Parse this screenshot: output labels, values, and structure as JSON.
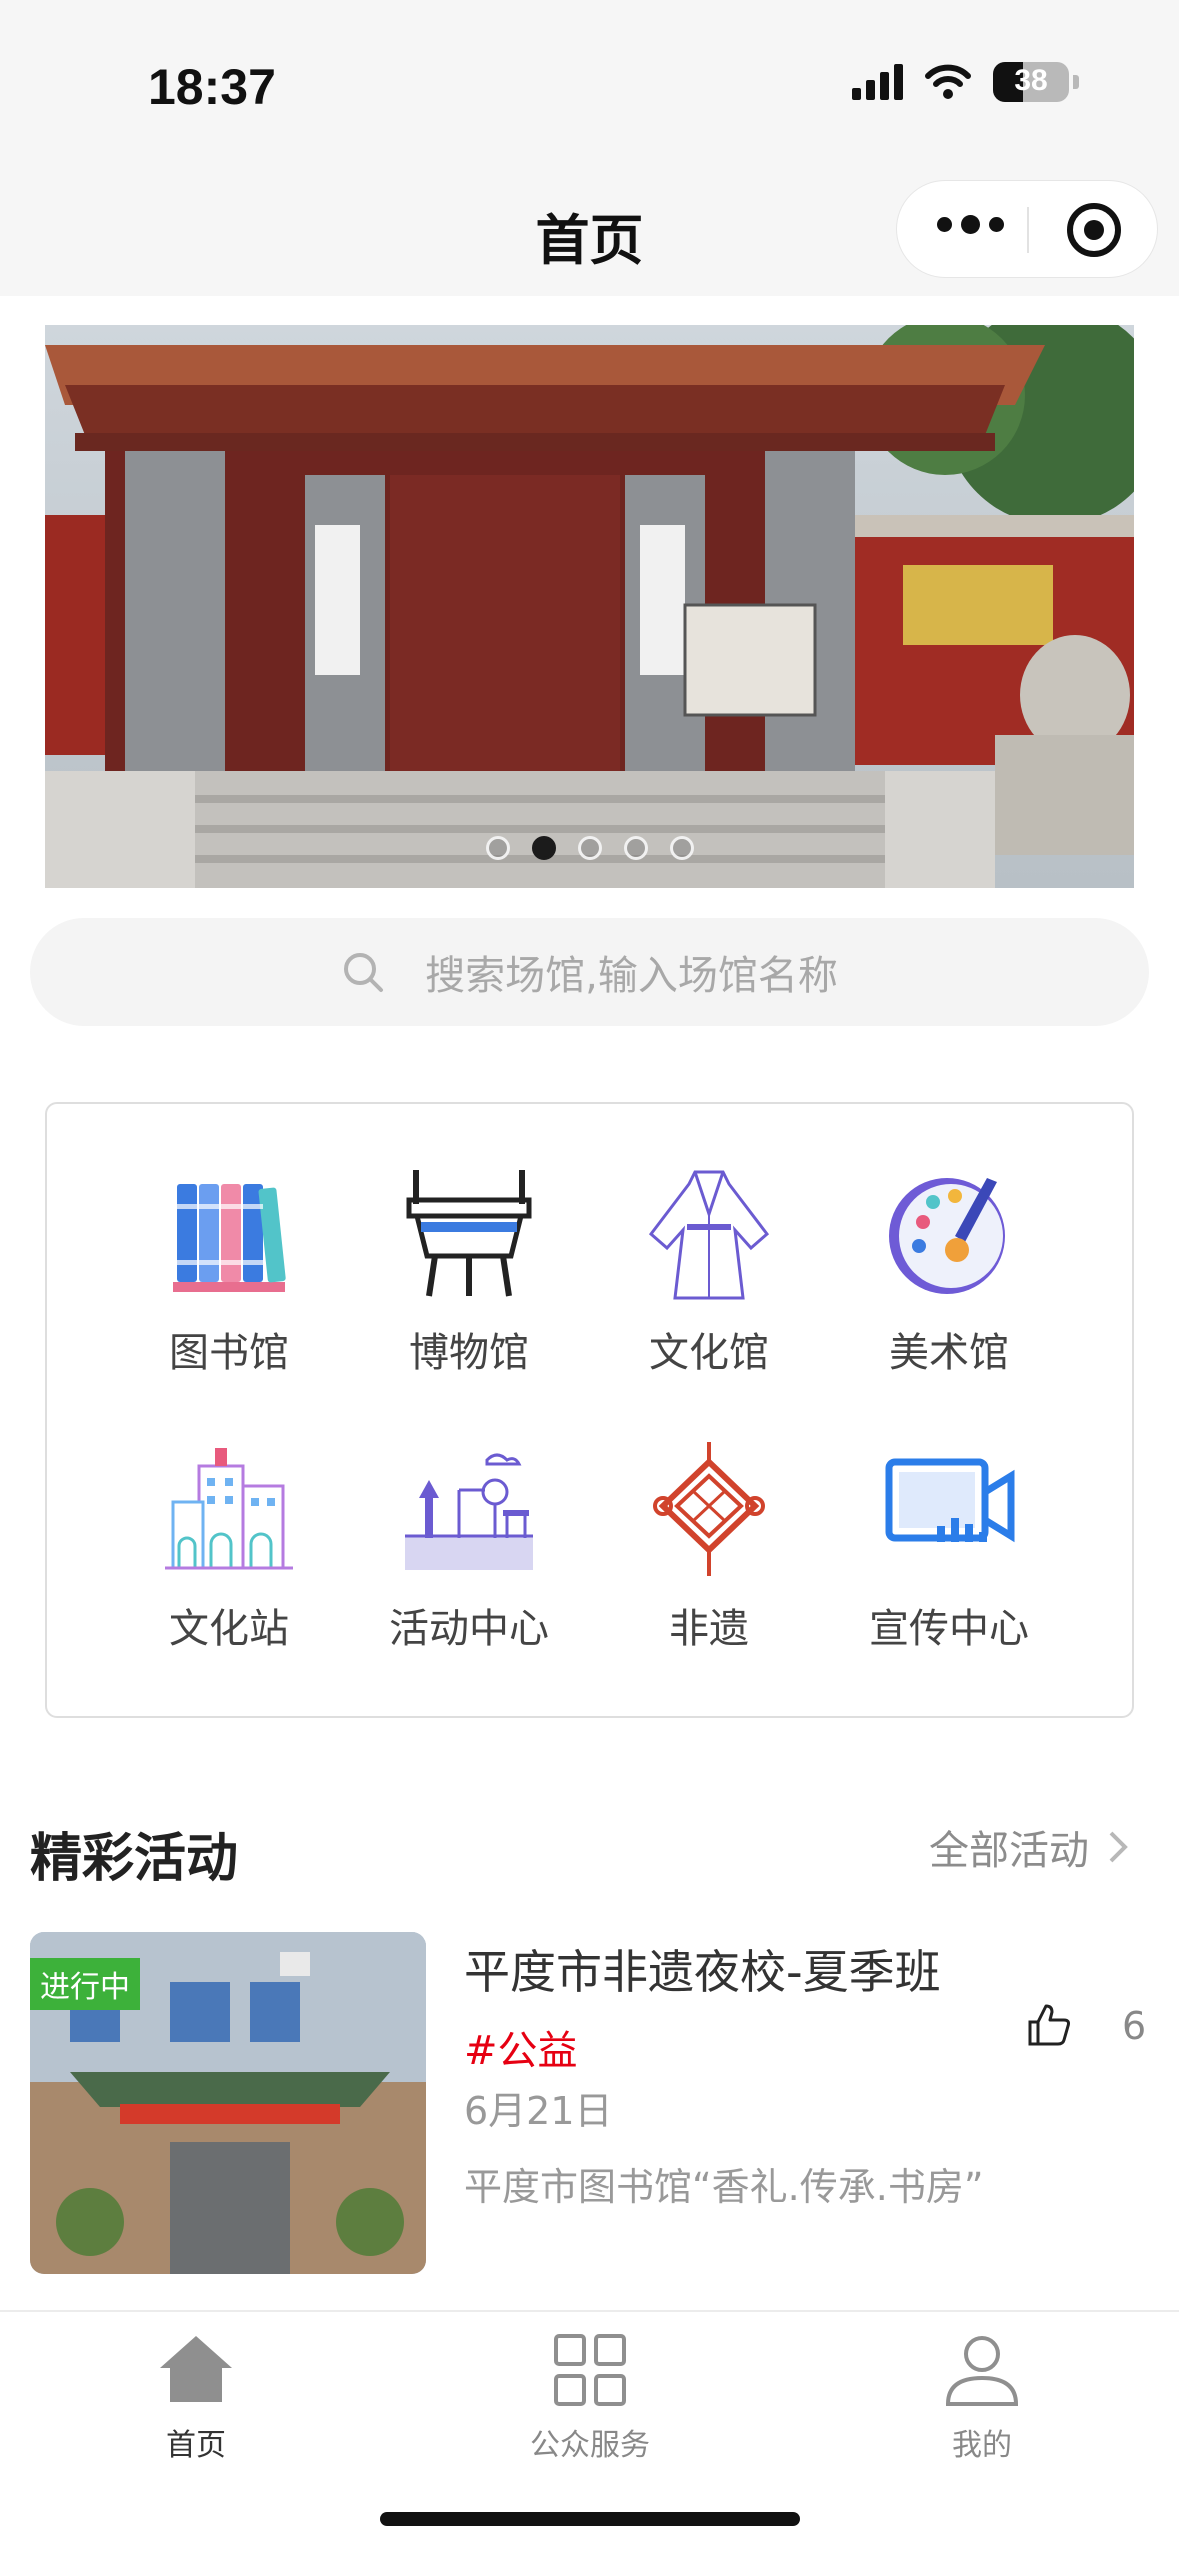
{
  "status_bar": {
    "time": "18:37",
    "battery": "38"
  },
  "nav": {
    "title": "首页"
  },
  "banner": {
    "slide_count": 5,
    "active_index": 1
  },
  "search": {
    "placeholder": "搜索场馆,输入场馆名称"
  },
  "categories": [
    {
      "label": "图书馆",
      "icon": "books-icon"
    },
    {
      "label": "博物馆",
      "icon": "bronze-ding-icon"
    },
    {
      "label": "文化馆",
      "icon": "hanfu-robe-icon"
    },
    {
      "label": "美术馆",
      "icon": "paint-palette-icon"
    },
    {
      "label": "文化站",
      "icon": "buildings-icon"
    },
    {
      "label": "活动中心",
      "icon": "playground-icon"
    },
    {
      "label": "非遗",
      "icon": "chinese-knot-icon"
    },
    {
      "label": "宣传中心",
      "icon": "video-camera-icon"
    }
  ],
  "section": {
    "title": "精彩活动",
    "more_label": "全部活动"
  },
  "activity": {
    "badge": "进行中",
    "title": "平度市非遗夜校-夏季班",
    "tag": "#公益",
    "date": "6月21日",
    "venue": "平度市图书馆“香礼.传承.书房”",
    "likes": "6"
  },
  "tabbar": [
    {
      "label": "首页",
      "icon": "home-icon",
      "active": true
    },
    {
      "label": "公众服务",
      "icon": "grid-icon",
      "active": false
    },
    {
      "label": "我的",
      "icon": "user-icon",
      "active": false
    }
  ],
  "colors": {
    "accent_red": "#e60012",
    "badge_green": "#3db13a",
    "icon_blue": "#2b7de9"
  }
}
